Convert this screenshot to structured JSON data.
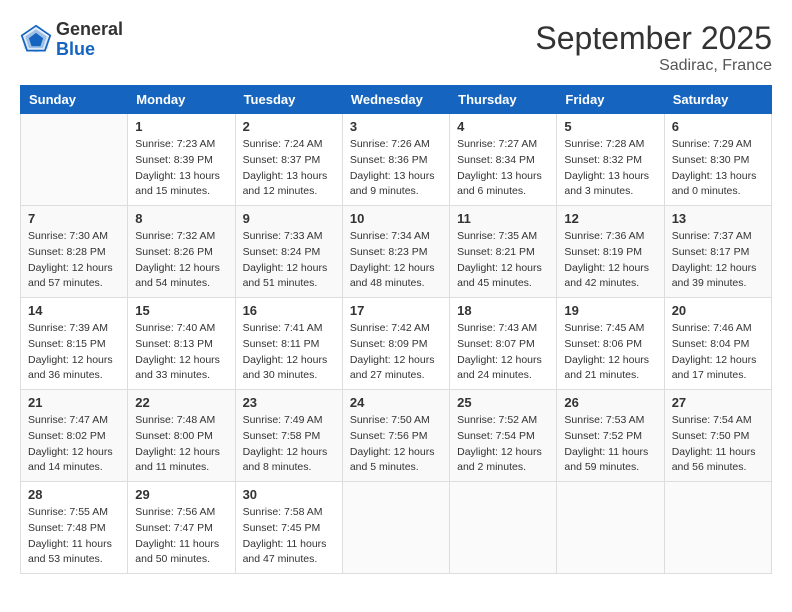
{
  "logo": {
    "general": "General",
    "blue": "Blue"
  },
  "header": {
    "month": "September 2025",
    "location": "Sadirac, France"
  },
  "weekdays": [
    "Sunday",
    "Monday",
    "Tuesday",
    "Wednesday",
    "Thursday",
    "Friday",
    "Saturday"
  ],
  "weeks": [
    [
      {
        "day": "",
        "sunrise": "",
        "sunset": "",
        "daylight": ""
      },
      {
        "day": "1",
        "sunrise": "Sunrise: 7:23 AM",
        "sunset": "Sunset: 8:39 PM",
        "daylight": "Daylight: 13 hours and 15 minutes."
      },
      {
        "day": "2",
        "sunrise": "Sunrise: 7:24 AM",
        "sunset": "Sunset: 8:37 PM",
        "daylight": "Daylight: 13 hours and 12 minutes."
      },
      {
        "day": "3",
        "sunrise": "Sunrise: 7:26 AM",
        "sunset": "Sunset: 8:36 PM",
        "daylight": "Daylight: 13 hours and 9 minutes."
      },
      {
        "day": "4",
        "sunrise": "Sunrise: 7:27 AM",
        "sunset": "Sunset: 8:34 PM",
        "daylight": "Daylight: 13 hours and 6 minutes."
      },
      {
        "day": "5",
        "sunrise": "Sunrise: 7:28 AM",
        "sunset": "Sunset: 8:32 PM",
        "daylight": "Daylight: 13 hours and 3 minutes."
      },
      {
        "day": "6",
        "sunrise": "Sunrise: 7:29 AM",
        "sunset": "Sunset: 8:30 PM",
        "daylight": "Daylight: 13 hours and 0 minutes."
      }
    ],
    [
      {
        "day": "7",
        "sunrise": "Sunrise: 7:30 AM",
        "sunset": "Sunset: 8:28 PM",
        "daylight": "Daylight: 12 hours and 57 minutes."
      },
      {
        "day": "8",
        "sunrise": "Sunrise: 7:32 AM",
        "sunset": "Sunset: 8:26 PM",
        "daylight": "Daylight: 12 hours and 54 minutes."
      },
      {
        "day": "9",
        "sunrise": "Sunrise: 7:33 AM",
        "sunset": "Sunset: 8:24 PM",
        "daylight": "Daylight: 12 hours and 51 minutes."
      },
      {
        "day": "10",
        "sunrise": "Sunrise: 7:34 AM",
        "sunset": "Sunset: 8:23 PM",
        "daylight": "Daylight: 12 hours and 48 minutes."
      },
      {
        "day": "11",
        "sunrise": "Sunrise: 7:35 AM",
        "sunset": "Sunset: 8:21 PM",
        "daylight": "Daylight: 12 hours and 45 minutes."
      },
      {
        "day": "12",
        "sunrise": "Sunrise: 7:36 AM",
        "sunset": "Sunset: 8:19 PM",
        "daylight": "Daylight: 12 hours and 42 minutes."
      },
      {
        "day": "13",
        "sunrise": "Sunrise: 7:37 AM",
        "sunset": "Sunset: 8:17 PM",
        "daylight": "Daylight: 12 hours and 39 minutes."
      }
    ],
    [
      {
        "day": "14",
        "sunrise": "Sunrise: 7:39 AM",
        "sunset": "Sunset: 8:15 PM",
        "daylight": "Daylight: 12 hours and 36 minutes."
      },
      {
        "day": "15",
        "sunrise": "Sunrise: 7:40 AM",
        "sunset": "Sunset: 8:13 PM",
        "daylight": "Daylight: 12 hours and 33 minutes."
      },
      {
        "day": "16",
        "sunrise": "Sunrise: 7:41 AM",
        "sunset": "Sunset: 8:11 PM",
        "daylight": "Daylight: 12 hours and 30 minutes."
      },
      {
        "day": "17",
        "sunrise": "Sunrise: 7:42 AM",
        "sunset": "Sunset: 8:09 PM",
        "daylight": "Daylight: 12 hours and 27 minutes."
      },
      {
        "day": "18",
        "sunrise": "Sunrise: 7:43 AM",
        "sunset": "Sunset: 8:07 PM",
        "daylight": "Daylight: 12 hours and 24 minutes."
      },
      {
        "day": "19",
        "sunrise": "Sunrise: 7:45 AM",
        "sunset": "Sunset: 8:06 PM",
        "daylight": "Daylight: 12 hours and 21 minutes."
      },
      {
        "day": "20",
        "sunrise": "Sunrise: 7:46 AM",
        "sunset": "Sunset: 8:04 PM",
        "daylight": "Daylight: 12 hours and 17 minutes."
      }
    ],
    [
      {
        "day": "21",
        "sunrise": "Sunrise: 7:47 AM",
        "sunset": "Sunset: 8:02 PM",
        "daylight": "Daylight: 12 hours and 14 minutes."
      },
      {
        "day": "22",
        "sunrise": "Sunrise: 7:48 AM",
        "sunset": "Sunset: 8:00 PM",
        "daylight": "Daylight: 12 hours and 11 minutes."
      },
      {
        "day": "23",
        "sunrise": "Sunrise: 7:49 AM",
        "sunset": "Sunset: 7:58 PM",
        "daylight": "Daylight: 12 hours and 8 minutes."
      },
      {
        "day": "24",
        "sunrise": "Sunrise: 7:50 AM",
        "sunset": "Sunset: 7:56 PM",
        "daylight": "Daylight: 12 hours and 5 minutes."
      },
      {
        "day": "25",
        "sunrise": "Sunrise: 7:52 AM",
        "sunset": "Sunset: 7:54 PM",
        "daylight": "Daylight: 12 hours and 2 minutes."
      },
      {
        "day": "26",
        "sunrise": "Sunrise: 7:53 AM",
        "sunset": "Sunset: 7:52 PM",
        "daylight": "Daylight: 11 hours and 59 minutes."
      },
      {
        "day": "27",
        "sunrise": "Sunrise: 7:54 AM",
        "sunset": "Sunset: 7:50 PM",
        "daylight": "Daylight: 11 hours and 56 minutes."
      }
    ],
    [
      {
        "day": "28",
        "sunrise": "Sunrise: 7:55 AM",
        "sunset": "Sunset: 7:48 PM",
        "daylight": "Daylight: 11 hours and 53 minutes."
      },
      {
        "day": "29",
        "sunrise": "Sunrise: 7:56 AM",
        "sunset": "Sunset: 7:47 PM",
        "daylight": "Daylight: 11 hours and 50 minutes."
      },
      {
        "day": "30",
        "sunrise": "Sunrise: 7:58 AM",
        "sunset": "Sunset: 7:45 PM",
        "daylight": "Daylight: 11 hours and 47 minutes."
      },
      {
        "day": "",
        "sunrise": "",
        "sunset": "",
        "daylight": ""
      },
      {
        "day": "",
        "sunrise": "",
        "sunset": "",
        "daylight": ""
      },
      {
        "day": "",
        "sunrise": "",
        "sunset": "",
        "daylight": ""
      },
      {
        "day": "",
        "sunrise": "",
        "sunset": "",
        "daylight": ""
      }
    ]
  ]
}
